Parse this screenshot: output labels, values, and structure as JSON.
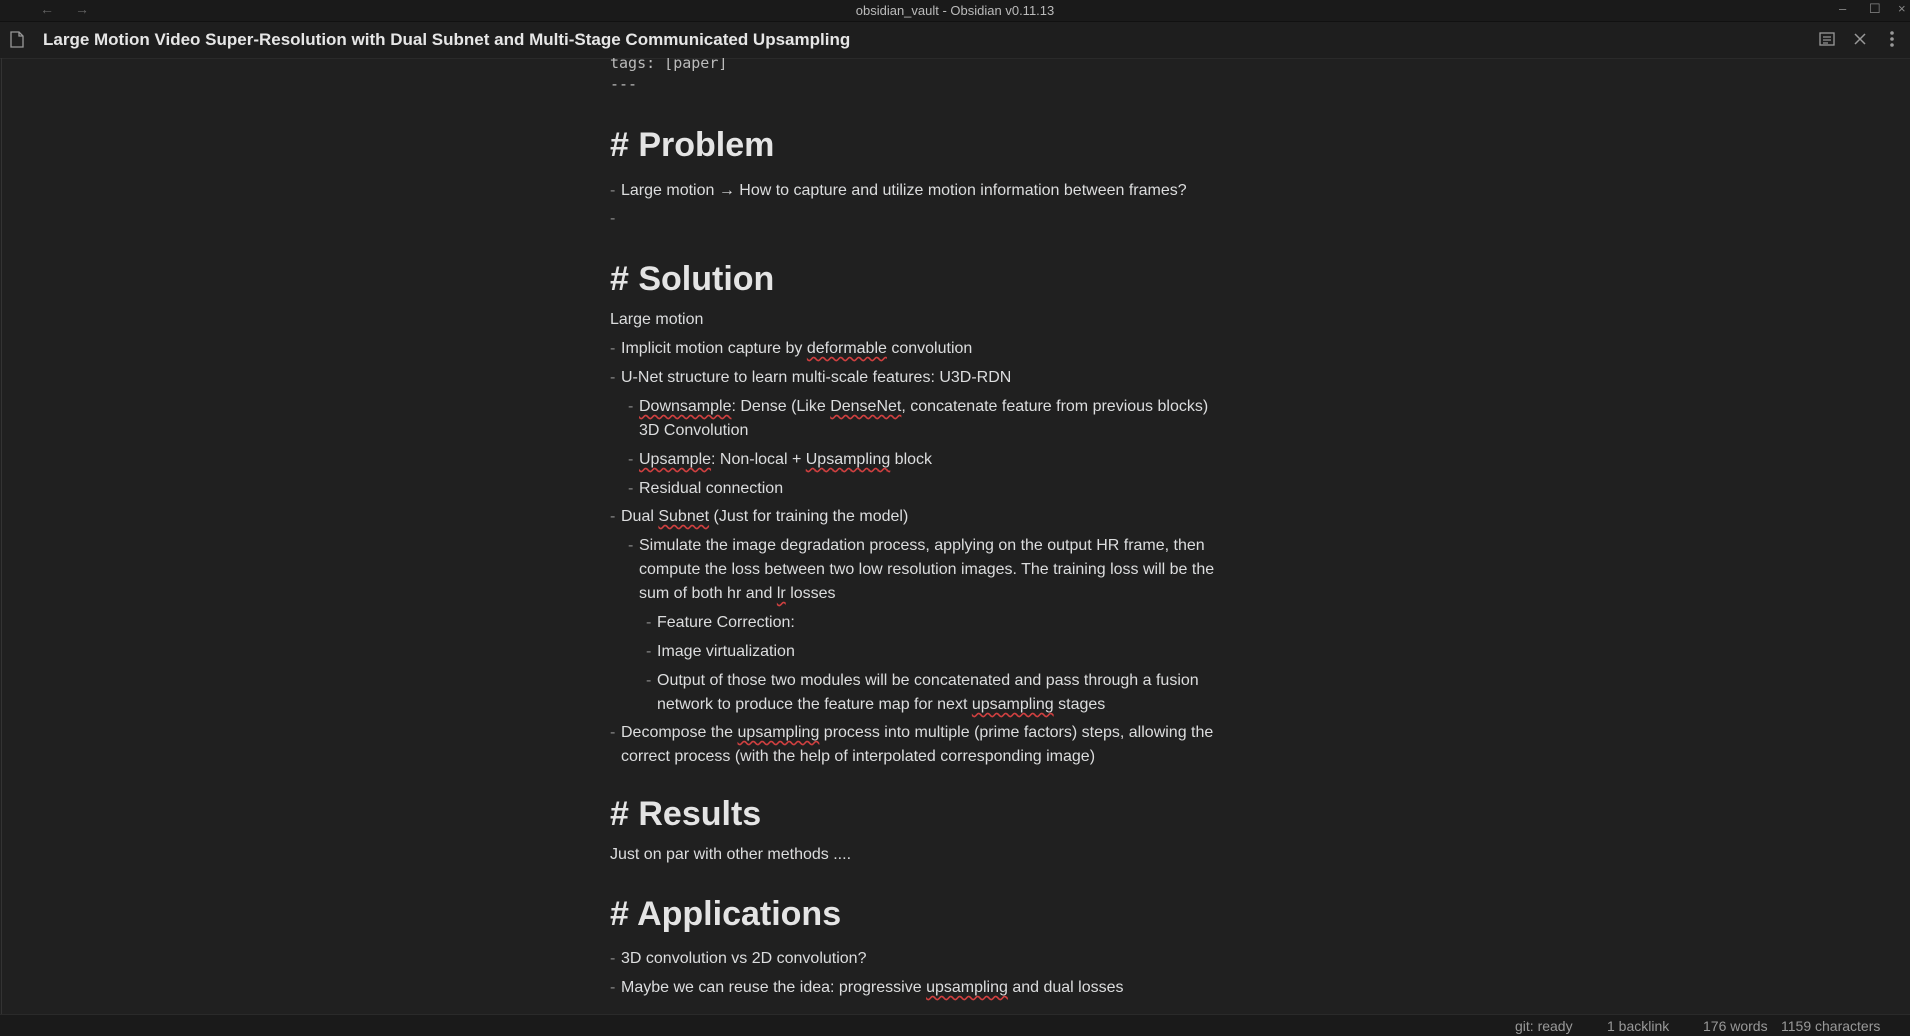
{
  "window": {
    "title": "obsidian_vault - Obsidian v0.11.13",
    "back_glyph": "←",
    "forward_glyph": "→",
    "min_glyph": "–",
    "max_glyph": "☐",
    "close_glyph": "×"
  },
  "note": {
    "title": "Large Motion Video Super-Resolution with Dual Subnet and Multi-Stage Communicated Upsampling"
  },
  "frontmatter": {
    "tags": "tags: [paper]",
    "end": "---"
  },
  "dash": "-",
  "problem": {
    "heading": "# Problem",
    "item1": "Large motion → How to capture and utilize motion information between frames?"
  },
  "solution": {
    "heading": "# Solution",
    "intro": "Large motion",
    "b1_pre": "Implicit motion capture by ",
    "b1_sq": "deformable",
    "b1_post": " convolution",
    "b2": "U-Net structure to learn multi-scale features: U3D-RDN",
    "b2a_sq1": "Downsample",
    "b2a_mid": ": Dense (Like ",
    "b2a_sq2": "DenseNet",
    "b2a_post": ", concatenate feature from previous blocks)",
    "b2a_line2": "3D Convolution",
    "b2b_sq1": "Upsample",
    "b2b_mid": ": Non-local + ",
    "b2b_sq2": "Upsampling",
    "b2b_post": " block",
    "b2c": "Residual connection",
    "b3_pre": "Dual ",
    "b3_sq": "Subnet",
    "b3_post": " (Just for training the model)",
    "b3a_l1": "Simulate the image degradation process, applying on the output HR frame, then",
    "b3a_l2": "compute the loss between two low resolution images. The training loss will be the",
    "b3a_l3_pre": "sum of both hr and ",
    "b3a_l3_sq": "lr",
    "b3a_l3_post": " losses",
    "b3a1": "Feature Correction:",
    "b3a2": "Image virtualization",
    "b3a3_l1": "Output of those two modules will be concatenated and pass through a fusion",
    "b3a3_l2_pre": "network to produce the feature map for next ",
    "b3a3_l2_sq": "upsampling",
    "b3a3_l2_post": " stages",
    "b4_l1_pre": "Decompose the ",
    "b4_l1_sq": "upsampling",
    "b4_l1_post": " process into multiple (prime factors) steps, allowing the",
    "b4_l2": "correct process (with the help of interpolated corresponding image)"
  },
  "results": {
    "heading": "# Results",
    "text": "Just on par with other methods ...."
  },
  "applications": {
    "heading": "# Applications",
    "a1": "3D convolution vs 2D convolution?",
    "a2_pre": "Maybe we can reuse the idea: progressive ",
    "a2_sq": "upsampling",
    "a2_post": " and dual losses"
  },
  "status": {
    "git": "git: ready",
    "backlinks": "1 backlink",
    "words": "176 words",
    "chars": "1159 characters"
  }
}
